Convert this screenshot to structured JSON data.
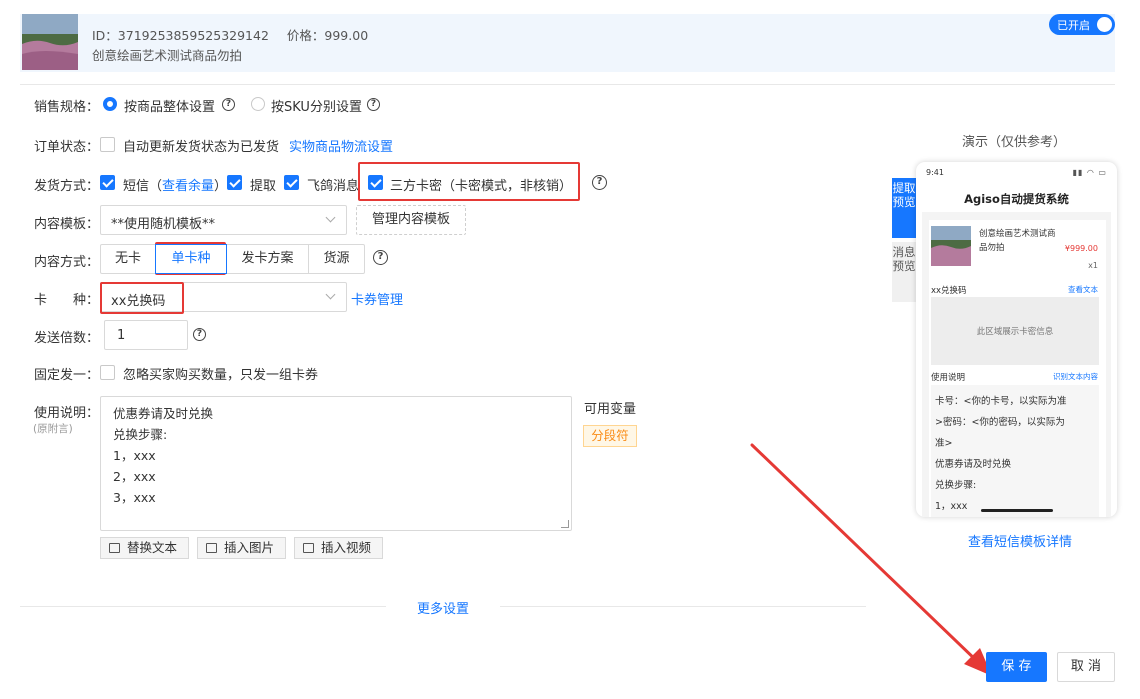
{
  "product": {
    "id_label": "ID：3719253859525329142",
    "price_label": "价格：999.00",
    "title": "创意绘画艺术测试商品勿拍",
    "toggle_text": "已开启"
  },
  "form": {
    "sale_spec": {
      "label": "销售规格：",
      "opt1": "按商品整体设置",
      "opt2": "按SKU分别设置"
    },
    "order_status": {
      "label": "订单状态：",
      "text": "自动更新发货状态为已发货",
      "link": "实物商品物流设置"
    },
    "delivery": {
      "label": "发货方式：",
      "sms": "短信（",
      "sms_link": "查看余量",
      "sms_close": "）",
      "pickup": "提取",
      "feige": "飞鸽消息",
      "third": "三方卡密（卡密模式，非核销）"
    },
    "template": {
      "label": "内容模板：",
      "value": "**使用随机模板**",
      "manage": "管理内容模板"
    },
    "content_mode": {
      "label": "内容方式：",
      "options": [
        "无卡",
        "单卡种",
        "发卡方案",
        "货源"
      ]
    },
    "card_type": {
      "label": "卡　　种：",
      "value": "xx兑换码",
      "manage": "卡券管理"
    },
    "multiplier": {
      "label": "发送倍数：",
      "value": "1"
    },
    "fixed": {
      "label": "固定发一：",
      "text": "忽略买家购买数量，只发一组卡券"
    },
    "usage": {
      "label": "使用说明：",
      "sublabel": "(原附言)",
      "lines": [
        "优惠券请及时兑换",
        "兑换步骤:",
        "1，xxx",
        "2，xxx",
        "3，xxx"
      ],
      "vars_title": "可用变量",
      "var_tag": "分段符"
    },
    "tools": {
      "replace": "替换文本",
      "image": "插入图片",
      "video": "插入视频"
    }
  },
  "more_settings": "更多设置",
  "preview": {
    "title": "演示（仅供参考）",
    "tab_active": "提取预览",
    "tab_inactive": "消息预览",
    "status_time": "9:41",
    "status_icons": "▮▮ ◠ ▭",
    "app_title": "Agiso自动提货系统",
    "product_name": "创意绘画艺术测试商品勿拍",
    "price": "¥999.00",
    "qty": "x1",
    "code_label": "xx兑换码",
    "view_text": "查看文本",
    "box_text": "此区域展示卡密信息",
    "usage_label": "使用说明",
    "recognize": "识别文本内容",
    "note_lines": [
      "卡号：<你的卡号，以实际为准",
      ">密码：<你的密码，以实际为",
      "准>",
      "优惠券请及时兑换",
      "兑换步骤:",
      "1，xxx"
    ],
    "sms_detail_link": "查看短信模板详情"
  },
  "buttons": {
    "save": "保 存",
    "cancel": "取 消"
  },
  "colors": {
    "primary": "#1677ff",
    "highlight_red": "#e53935",
    "tag_orange": "#fa8c16"
  }
}
